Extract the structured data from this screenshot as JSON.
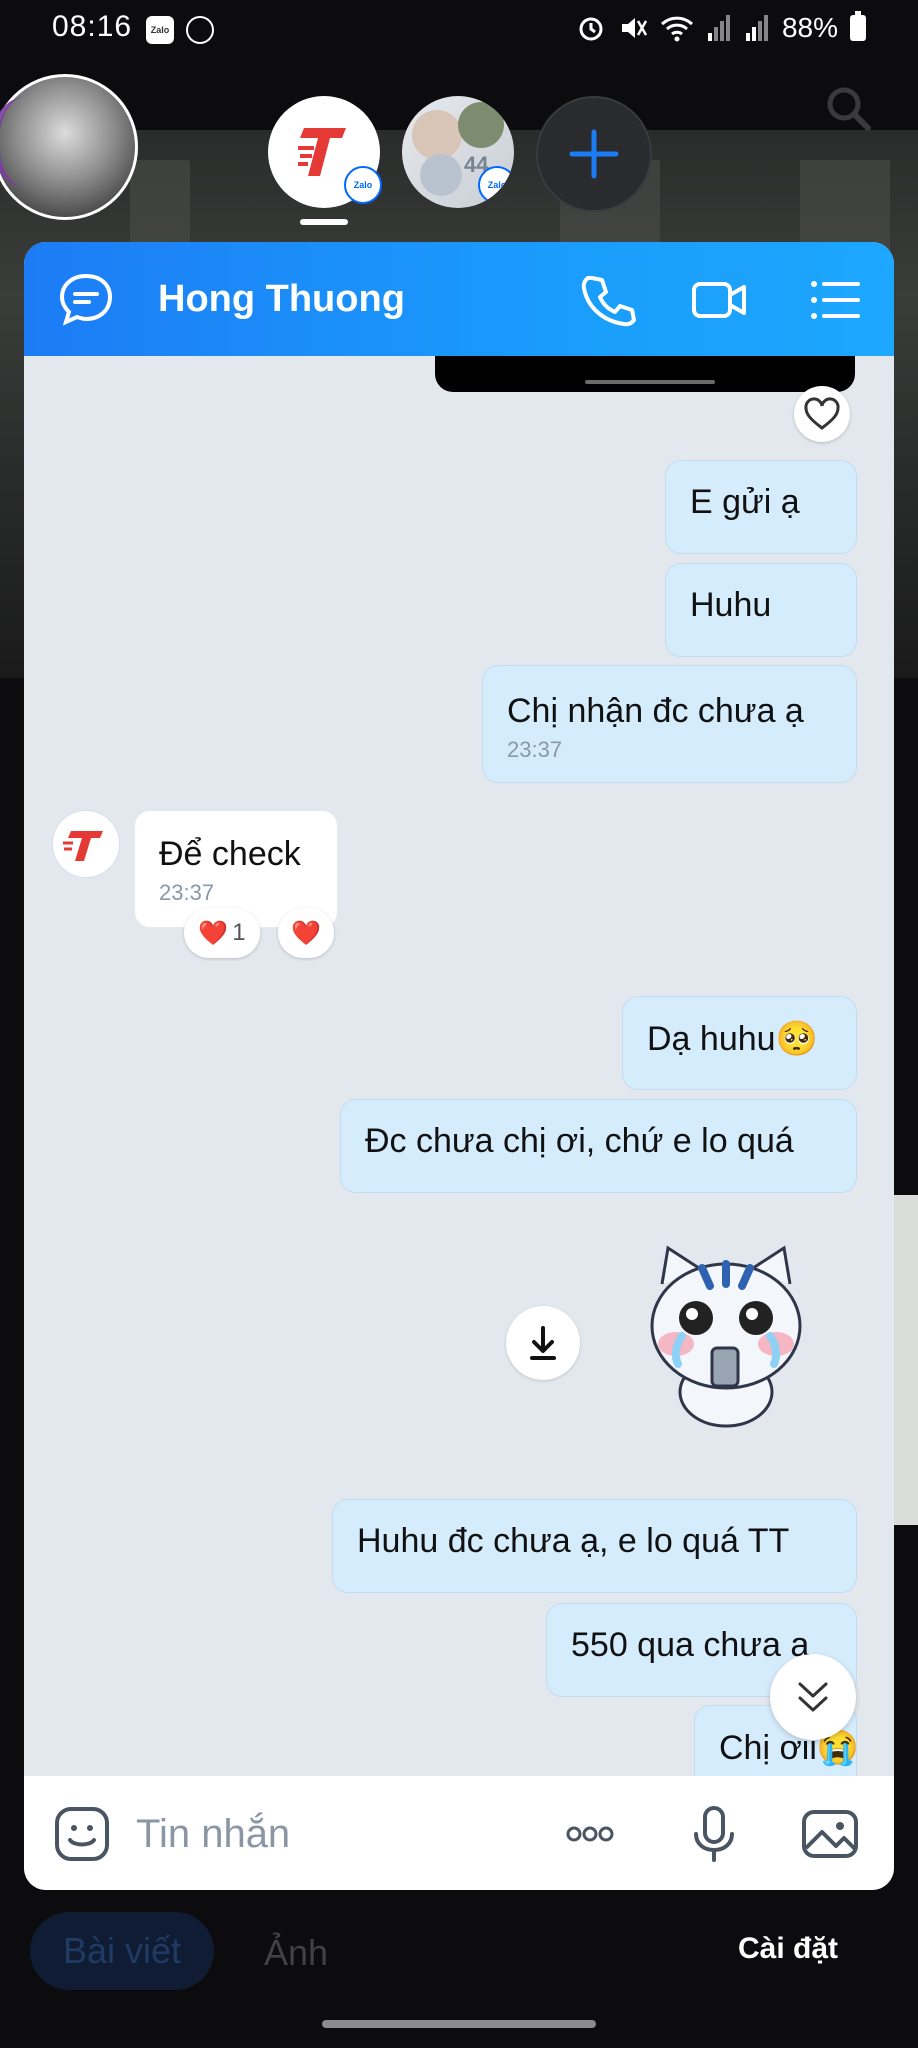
{
  "status_bar": {
    "time": "08:16",
    "battery": "88%",
    "zalo_badge": "Zalo"
  },
  "story_row": {
    "group_count": "44",
    "zalo_tag": "Zalo"
  },
  "chat": {
    "contact_name": "Hong Thuong",
    "messages": [
      {
        "dir": "out",
        "text": "E gửi ạ",
        "time": ""
      },
      {
        "dir": "out",
        "text": "Huhu",
        "time": ""
      },
      {
        "dir": "out",
        "text": "Chị nhận đc chưa ạ",
        "time": "23:37"
      },
      {
        "dir": "in",
        "text": "Để check",
        "time": "23:37"
      },
      {
        "dir": "out",
        "text": "Dạ huhu🥺",
        "time": ""
      },
      {
        "dir": "out",
        "text": "Đc chưa chị ơi, chứ e lo quá",
        "time": ""
      },
      {
        "dir": "out",
        "text": "Huhu đc chưa ạ, e lo quá TT",
        "time": ""
      },
      {
        "dir": "out",
        "text": "550 qua chưa ạ",
        "time": ""
      },
      {
        "dir": "out",
        "text": "Chị ơii😭",
        "time": ""
      }
    ],
    "reactions": [
      {
        "emoji": "❤️",
        "count": "1"
      },
      {
        "emoji": "❤️",
        "count": ""
      }
    ]
  },
  "input": {
    "placeholder": "Tin nhắn"
  },
  "bottom_tabs": {
    "posts": "Bài viết",
    "photos": "Ảnh",
    "settings": "Cài đặt"
  },
  "colors": {
    "header_blue": "#1a8cf8",
    "outgoing_bubble": "#d5ecfd",
    "chat_bg": "#e3e8ee",
    "accent_red": "#e53935"
  }
}
